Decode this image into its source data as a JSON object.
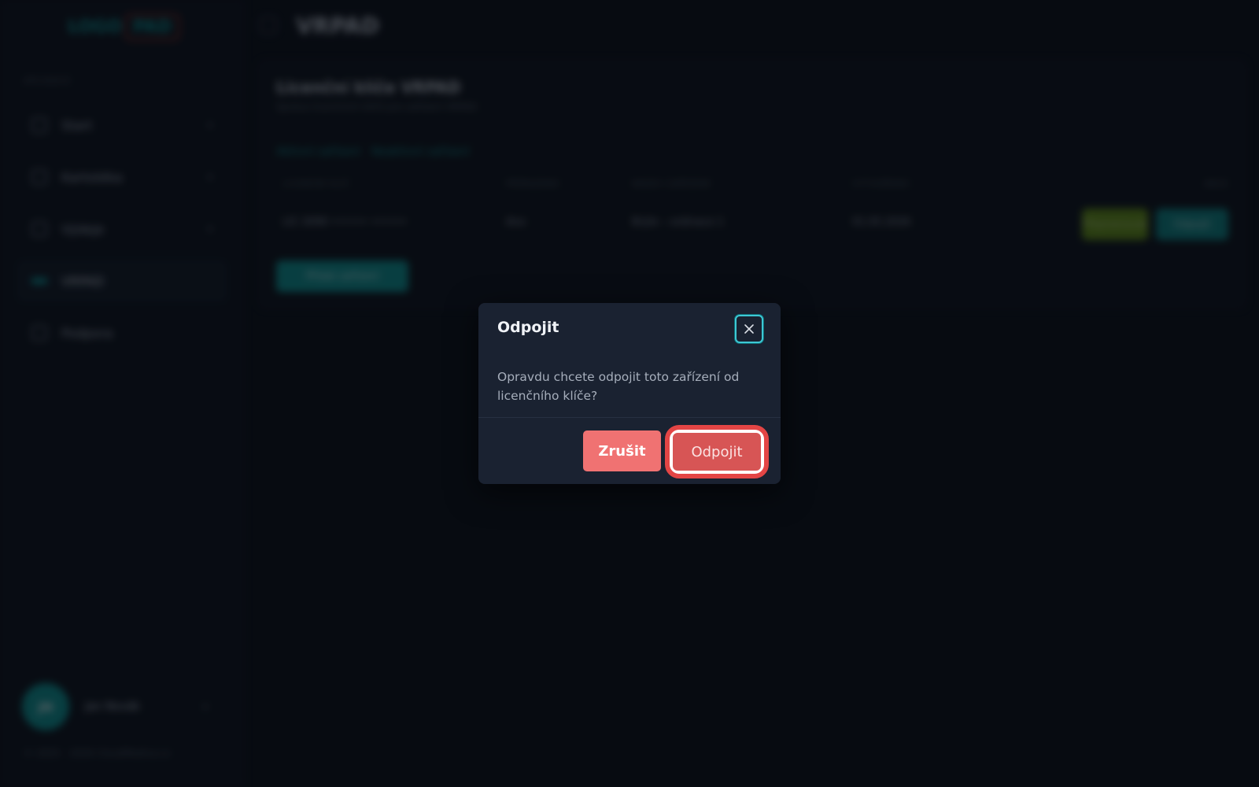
{
  "sidebar": {
    "logo_left": "LOGO",
    "logo_right": "PAD",
    "section_label": "Aplikace",
    "items": [
      {
        "label": "Start"
      },
      {
        "label": "Kartotéka"
      },
      {
        "label": "Výdeje"
      },
      {
        "label": "VRPAD"
      },
      {
        "label": "Podpora"
      }
    ],
    "user": {
      "initials": "JN",
      "name": "Jan Novák"
    },
    "copyright": "© 2025 - 2026 CloudMedica.cz"
  },
  "topbar": {
    "title": "VRPAD"
  },
  "card": {
    "title": "Licenční klíče VRPAD",
    "subtitle": "Správa licenčních klíčů pro zařízení VRPAD",
    "tabs": [
      "Aktivní zařízení",
      "Neaktivní zařízení"
    ],
    "columns": [
      "Licenční klíč",
      "Přiřazeno",
      "Název zařízení",
      "Vytvořeno",
      "Akce"
    ],
    "rows": [
      {
        "key": "LIC-3090 •••••• ••••••",
        "assigned": "Ano",
        "device": "Brýle – ordinace 1",
        "created": "01.05.2026"
      }
    ],
    "btn_green": "Přejmenovat",
    "btn_teal": "Odpojit",
    "btn_add": "Přidat zařízení"
  },
  "modal": {
    "title": "Odpojit",
    "body": "Opravdu chcete odpojit toto zařízení od licenčního klíče?",
    "cancel_label": "Zrušit",
    "confirm_label": "Odpojit"
  },
  "colors": {
    "accent": "#0f9e9b",
    "danger": "#f07272",
    "confirm": "#d75555",
    "highlight_ring": "#e34545"
  }
}
